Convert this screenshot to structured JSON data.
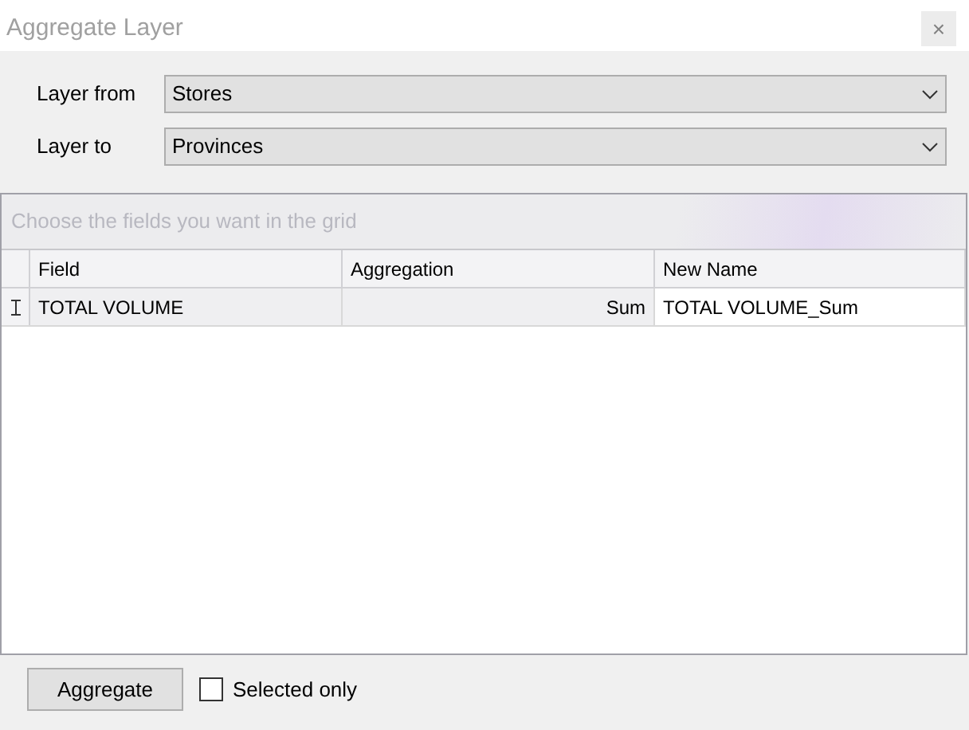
{
  "window": {
    "title": "Aggregate Layer",
    "close": "×"
  },
  "layer_from": {
    "label": "Layer from",
    "value": "Stores"
  },
  "layer_to": {
    "label": "Layer to",
    "value": "Provinces"
  },
  "grid": {
    "hint": "Choose the fields you want in the grid",
    "columns": [
      "Field",
      "Aggregation",
      "New Name"
    ],
    "rows": [
      {
        "field": "TOTAL VOLUME",
        "aggregation": "Sum",
        "new_name": "TOTAL VOLUME_Sum",
        "editing": true
      }
    ]
  },
  "aggregate_button": "Aggregate",
  "selected_only": {
    "label": "Selected only",
    "checked": false
  }
}
